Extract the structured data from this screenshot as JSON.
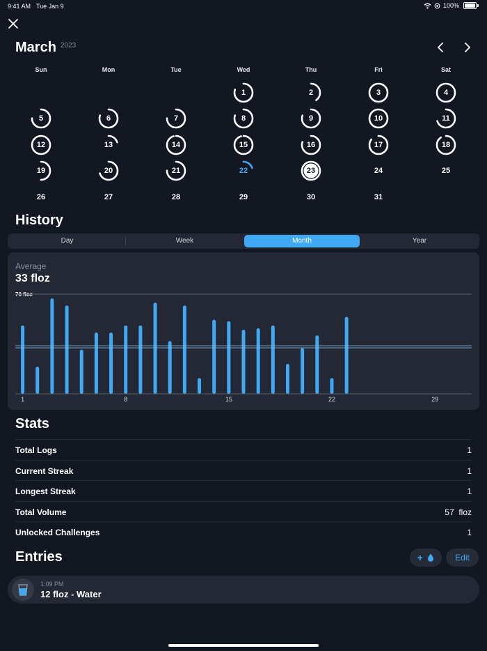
{
  "status_bar": {
    "time": "9:41 AM",
    "date": "Tue Jan 9",
    "battery": "100%"
  },
  "calendar": {
    "month": "March",
    "year": "2023",
    "weekdays": [
      "Sun",
      "Mon",
      "Tue",
      "Wed",
      "Thu",
      "Fri",
      "Sat"
    ],
    "days": [
      {
        "day": "1",
        "progress": 0.8
      },
      {
        "day": "2",
        "progress": 0.4
      },
      {
        "day": "3",
        "progress": 1
      },
      {
        "day": "4",
        "progress": 1
      },
      {
        "day": "5",
        "progress": 0.75
      },
      {
        "day": "6",
        "progress": 0.8
      },
      {
        "day": "7",
        "progress": 0.75
      },
      {
        "day": "8",
        "progress": 0.8
      },
      {
        "day": "9",
        "progress": 0.8
      },
      {
        "day": "10",
        "progress": 1
      },
      {
        "day": "11",
        "progress": 0.7
      },
      {
        "day": "12",
        "progress": 1
      },
      {
        "day": "13",
        "progress": 0.2
      },
      {
        "day": "14",
        "progress": 0.95
      },
      {
        "day": "15",
        "progress": 0.95
      },
      {
        "day": "16",
        "progress": 0.8
      },
      {
        "day": "17",
        "progress": 0.85
      },
      {
        "day": "18",
        "progress": 0.9
      },
      {
        "day": "19",
        "progress": 0.5
      },
      {
        "day": "20",
        "progress": 0.7
      },
      {
        "day": "21",
        "progress": 0.75
      },
      {
        "day": "22",
        "progress": 0.2
      },
      {
        "day": "23",
        "progress": 1
      },
      {
        "day": "24",
        "progress": 0
      },
      {
        "day": "25",
        "progress": 0
      },
      {
        "day": "26",
        "progress": 0
      },
      {
        "day": "27",
        "progress": 0
      },
      {
        "day": "28",
        "progress": 0
      },
      {
        "day": "29",
        "progress": 0
      },
      {
        "day": "30",
        "progress": 0
      },
      {
        "day": "31",
        "progress": 0
      }
    ],
    "today": "22",
    "selected": "23"
  },
  "history": {
    "title": "History",
    "tabs": [
      "Day",
      "Week",
      "Month",
      "Year"
    ],
    "active_tab": "Month",
    "average_label": "Average",
    "average_value": "33 floz"
  },
  "chart_data": {
    "type": "bar",
    "x": [
      1,
      2,
      3,
      4,
      5,
      6,
      7,
      8,
      9,
      10,
      11,
      12,
      13,
      14,
      15,
      16,
      17,
      18,
      19,
      20,
      21,
      22,
      23
    ],
    "values": [
      48,
      19,
      67,
      62,
      31,
      43,
      43,
      48,
      48,
      64,
      37,
      62,
      11,
      52,
      51,
      45,
      46,
      48,
      21,
      32,
      41,
      11,
      54
    ],
    "max_label": "70 floz",
    "average": 33,
    "x_ticks": [
      "1",
      "8",
      "15",
      "22",
      "29"
    ],
    "xlim": [
      1,
      31
    ],
    "ylim": [
      0,
      70
    ],
    "color": "#3fa9f5"
  },
  "stats": {
    "title": "Stats",
    "rows": [
      {
        "label": "Total Logs",
        "value": "1"
      },
      {
        "label": "Current Streak",
        "value": "1"
      },
      {
        "label": "Longest Streak",
        "value": "1"
      },
      {
        "label": "Total Volume",
        "value": "57  floz"
      },
      {
        "label": "Unlocked Challenges",
        "value": "1"
      }
    ]
  },
  "entries": {
    "title": "Entries",
    "add_label": "+",
    "edit_label": "Edit",
    "items": [
      {
        "time": "1:09 PM",
        "title": "12 floz - Water"
      }
    ]
  },
  "colors": {
    "accent": "#3fa9f5",
    "background": "#121722",
    "card": "#232834"
  }
}
